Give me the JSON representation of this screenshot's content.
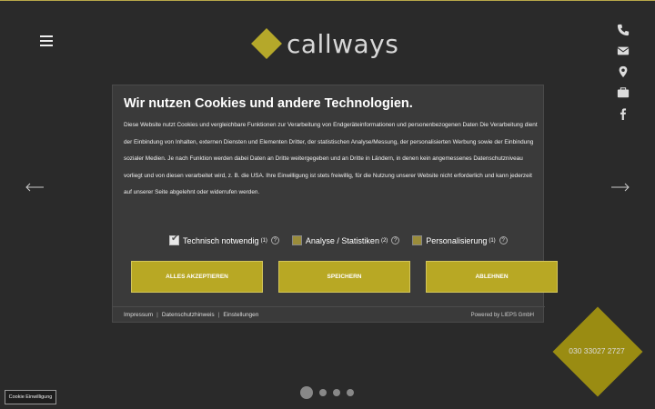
{
  "brand": {
    "name": "callways",
    "accent": "#b8a824"
  },
  "header": {
    "menu_icon": "hamburger-icon"
  },
  "side_icons": [
    "phone-icon",
    "envelope-icon",
    "map-pin-icon",
    "briefcase-icon",
    "facebook-icon"
  ],
  "cookie_modal": {
    "title": "Wir nutzen Cookies und andere Technologien.",
    "text": "Diese Website nutzt Cookies und vergleichbare Funktionen zur Verarbeitung von Endgeräteinformationen und personenbezogenen Daten Die Verarbeitung dient der Einbindung von Inhalten, externen Diensten und Elementen Dritter, der statistischen Analyse/Messung, der personalisierten Werbung sowie der Einbindung sozialer Medien. Je nach Funktion werden dabei Daten an Dritte weitergegeben und an Dritte in Ländern, in denen kein angemessenes Datenschutzniveau vorliegt und von diesen verarbeitet wird, z. B. die USA. Ihre Einwilligung ist stets freiwillig, für die Nutzung unserer Website nicht erforderlich und kann jederzeit auf unserer Seite abgelehnt oder widerrufen werden.",
    "checkboxes": [
      {
        "label": "Technisch notwendig",
        "count": "(1)",
        "checked": true
      },
      {
        "label": "Analyse / Statistiken",
        "count": "(2)",
        "checked": false
      },
      {
        "label": "Personalisierung",
        "count": "(1)",
        "checked": false
      }
    ],
    "help_symbol": "?",
    "buttons": {
      "accept_all": "ALLES AKZEPTIEREN",
      "save": "SPEICHERN",
      "reject": "ABLEHNEN"
    },
    "footer": {
      "links": [
        "Impressum",
        "Datenschutzhinweis",
        "Einstellungen"
      ],
      "separator": "|",
      "powered_by": "Powered by LIEPS GmbH"
    }
  },
  "phone": "030 33027 2727",
  "slider": {
    "total": 4,
    "active": 1
  },
  "cookie_settings_button": "Cookie Einwilligung"
}
